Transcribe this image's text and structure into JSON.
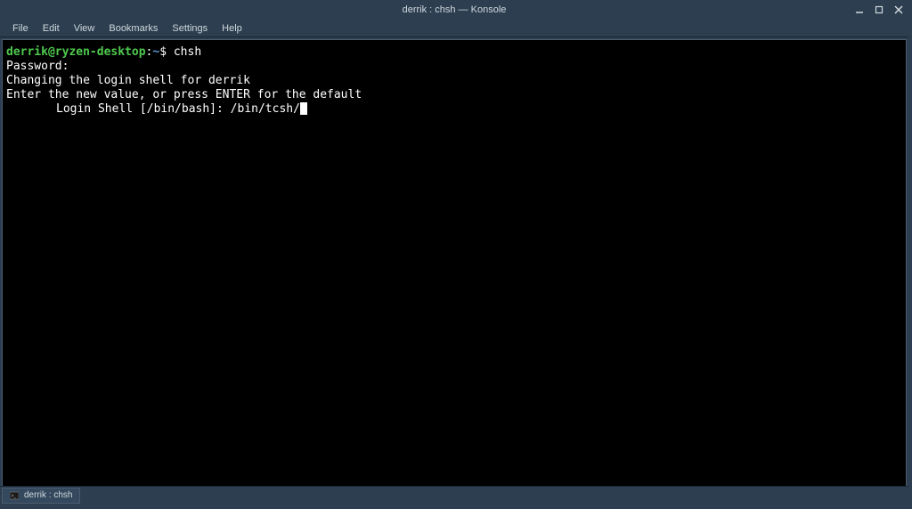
{
  "window": {
    "title": "derrik : chsh — Konsole"
  },
  "menubar": {
    "items": [
      "File",
      "Edit",
      "View",
      "Bookmarks",
      "Settings",
      "Help"
    ]
  },
  "terminal": {
    "prompt": {
      "user_host": "derrik@ryzen-desktop",
      "path": "~",
      "symbol": "$"
    },
    "command": "chsh",
    "lines": {
      "password": "Password:",
      "changing": "Changing the login shell for derrik",
      "enter_value": "Enter the new value, or press ENTER for the default",
      "login_shell_label": "Login Shell [/bin/bash]: ",
      "login_shell_input": "/bin/tcsh/"
    }
  },
  "taskbar": {
    "task_label": "derrik : chsh"
  }
}
